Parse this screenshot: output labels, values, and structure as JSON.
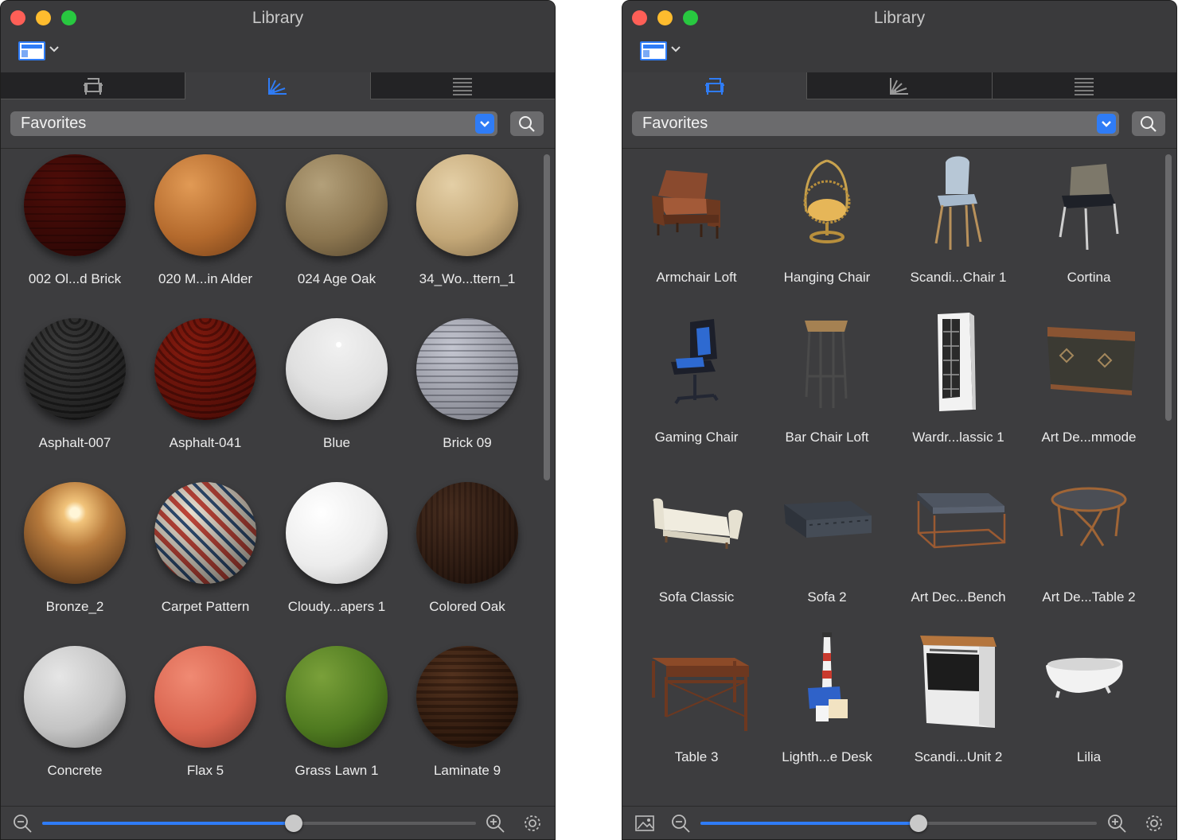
{
  "colors": {
    "accent": "#2f7cf6",
    "window_bg": "#3d3d3f",
    "label_text": "#ececec"
  },
  "left_window": {
    "title": "Library",
    "active_tab": "materials",
    "tabs": [
      {
        "icon": "furniture-icon"
      },
      {
        "icon": "materials-icon"
      },
      {
        "icon": "list-icon"
      }
    ],
    "filter": {
      "selected": "Favorites"
    },
    "zoom_slider_value": 0.58,
    "items": [
      {
        "label": "002 Ol...d Brick",
        "material": "old-brick"
      },
      {
        "label": "020 M...in Alder",
        "material": "alder-wood"
      },
      {
        "label": "024 Age Oak",
        "material": "aged-oak"
      },
      {
        "label": "34_Wo...ttern_1",
        "material": "wood-herringbone"
      },
      {
        "label": "Asphalt-007",
        "material": "grey-scales"
      },
      {
        "label": "Asphalt-041",
        "material": "red-scales"
      },
      {
        "label": "Blue",
        "material": "white-glossy"
      },
      {
        "label": "Brick 09",
        "material": "white-brick"
      },
      {
        "label": "Bronze_2",
        "material": "bronze"
      },
      {
        "label": "Carpet Pattern",
        "material": "carpet-pattern"
      },
      {
        "label": "Cloudy...apers 1",
        "material": "cloud-wallpaper"
      },
      {
        "label": "Colored Oak",
        "material": "colored-oak"
      },
      {
        "label": "Concrete",
        "material": "concrete"
      },
      {
        "label": "Flax 5",
        "material": "flax-salmon"
      },
      {
        "label": "Grass Lawn 1",
        "material": "grass"
      },
      {
        "label": "Laminate 9",
        "material": "laminate"
      }
    ]
  },
  "right_window": {
    "title": "Library",
    "active_tab": "furniture",
    "tabs": [
      {
        "icon": "furniture-icon"
      },
      {
        "icon": "materials-icon"
      },
      {
        "icon": "list-icon"
      }
    ],
    "filter": {
      "selected": "Favorites"
    },
    "zoom_slider_value": 0.55,
    "items": [
      {
        "label": "Armchair Loft",
        "icon": "armchair-icon"
      },
      {
        "label": "Hanging Chair",
        "icon": "hanging-chair-icon"
      },
      {
        "label": "Scandi...Chair 1",
        "icon": "scandi-chair-icon"
      },
      {
        "label": "Cortina",
        "icon": "cortina-chair-icon"
      },
      {
        "label": "Gaming Chair",
        "icon": "gaming-chair-icon"
      },
      {
        "label": "Bar Chair Loft",
        "icon": "bar-stool-icon"
      },
      {
        "label": "Wardr...lassic 1",
        "icon": "wardrobe-icon"
      },
      {
        "label": "Art De...mmode",
        "icon": "commode-icon"
      },
      {
        "label": "Sofa Classic",
        "icon": "sofa-classic-icon"
      },
      {
        "label": "Sofa 2",
        "icon": "chesterfield-sofa-icon"
      },
      {
        "label": "Art Dec...Bench",
        "icon": "bench-icon"
      },
      {
        "label": "Art De...Table 2",
        "icon": "round-table-icon"
      },
      {
        "label": "Table 3",
        "icon": "desk-table-icon"
      },
      {
        "label": "Lighth...e Desk",
        "icon": "lighthouse-desk-icon"
      },
      {
        "label": "Scandi...Unit 2",
        "icon": "kitchen-unit-icon"
      },
      {
        "label": "Lilia",
        "icon": "bathtub-icon"
      }
    ]
  }
}
